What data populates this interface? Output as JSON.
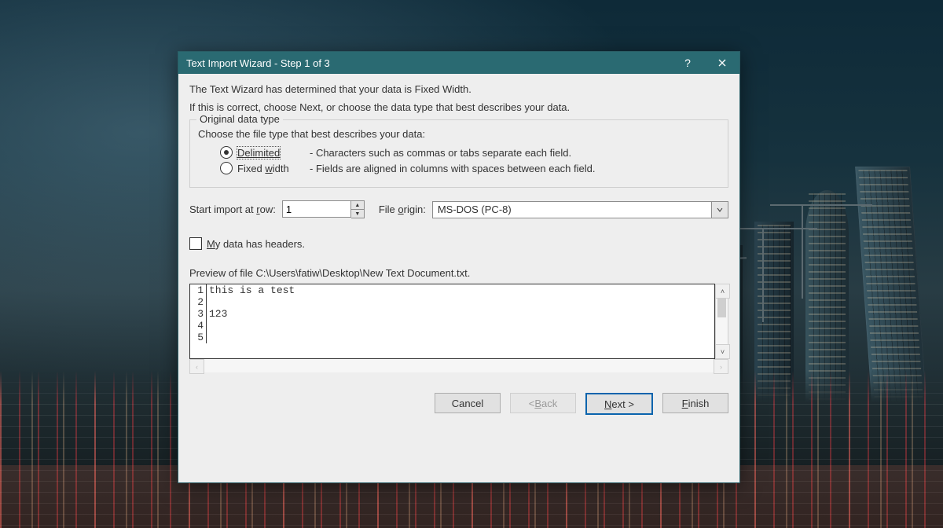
{
  "titlebar": {
    "title": "Text Import Wizard - Step 1 of 3"
  },
  "intro": {
    "line1": "The Text Wizard has determined that your data is Fixed Width.",
    "line2": "If this is correct, choose Next, or choose the data type that best describes your data."
  },
  "datatype": {
    "legend": "Original data type",
    "choose": "Choose the file type that best describes your data:",
    "delimited_label": "Delimited",
    "delimited_desc": "- Characters such as commas or tabs separate each field.",
    "fixed_label_pre": "Fixed ",
    "fixed_label_u": "w",
    "fixed_label_post": "idth",
    "fixed_desc": "- Fields are aligned in columns with spaces between each field."
  },
  "start": {
    "label_pre": "Start import at ",
    "label_u": "r",
    "label_post": "ow:",
    "value": "1",
    "origin_label_pre": "File ",
    "origin_label_u": "o",
    "origin_label_post": "rigin:",
    "origin_value": "MS-DOS (PC-8)"
  },
  "headers": {
    "label_u": "M",
    "label_post": "y data has headers."
  },
  "preview": {
    "label": "Preview of file C:\\Users\\fatiw\\Desktop\\New Text Document.txt.",
    "rows": [
      {
        "n": "1",
        "t": "this is a test"
      },
      {
        "n": "2",
        "t": ""
      },
      {
        "n": "3",
        "t": "123"
      },
      {
        "n": "4",
        "t": ""
      },
      {
        "n": "5",
        "t": ""
      }
    ]
  },
  "buttons": {
    "cancel": "Cancel",
    "back_pre": "< ",
    "back_u": "B",
    "back_post": "ack",
    "next_u": "N",
    "next_post": "ext >",
    "finish_u": "F",
    "finish_post": "inish"
  }
}
